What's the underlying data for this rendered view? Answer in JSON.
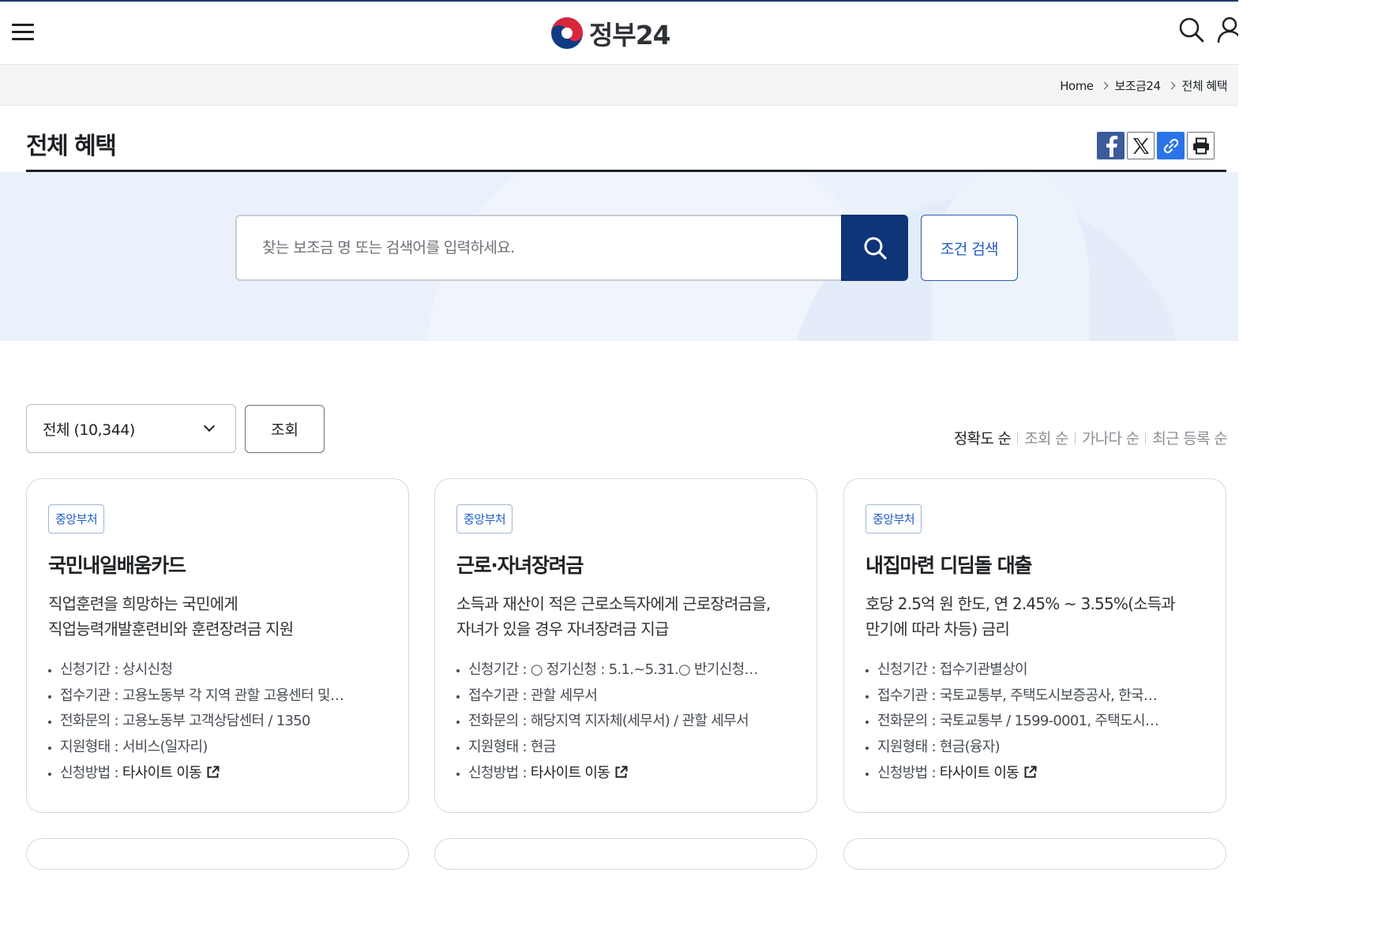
{
  "header": {
    "logo_text": "정부24"
  },
  "breadcrumb": [
    "Home",
    "보조금24",
    "전체 혜택"
  ],
  "page": {
    "title": "전체 혜택"
  },
  "search": {
    "placeholder": "찾는 보조금 명 또는 검색어를 입력하세요.",
    "condition_label": "조건 검색"
  },
  "filter": {
    "selected": "전체 (10,344)",
    "query_label": "조회"
  },
  "sort": [
    "정확도 순",
    "조회 순",
    "가나다 순",
    "최근 등록 순"
  ],
  "cards": [
    {
      "badge": "중앙부처",
      "title": "국민내일배움카드",
      "desc_line1": "직업훈련을 희망하는 국민에게",
      "desc_line2": "직업능력개발훈련비와 훈련장려금 지원",
      "info": [
        {
          "label": "신청기간 : ",
          "value": "상시신청"
        },
        {
          "label": "접수기관 : ",
          "value": "고용노동부 각 지역 관할 고용센터 및…"
        },
        {
          "label": "전화문의 : ",
          "value": "고용노동부 고객상담센터 / 1350"
        },
        {
          "label": "지원형태 : ",
          "value": "서비스(일자리)"
        },
        {
          "label": "신청방법 : ",
          "value": "타사이트 이동"
        }
      ]
    },
    {
      "badge": "중앙부처",
      "title": "근로·자녀장려금",
      "desc_line1": "소득과 재산이 적은 근로소득자에게 근로장려금을,",
      "desc_line2": "자녀가 있을 경우 자녀장려금 지급",
      "info": [
        {
          "label": "신청기간 : ",
          "value": "○ 정기신청 : 5.1.~5.31.○ 반기신청…"
        },
        {
          "label": "접수기관 : ",
          "value": "관할 세무서"
        },
        {
          "label": "전화문의 : ",
          "value": "해당지역 지자체(세무서) / 관할 세무서"
        },
        {
          "label": "지원형태 : ",
          "value": "현금"
        },
        {
          "label": "신청방법 : ",
          "value": "타사이트 이동"
        }
      ]
    },
    {
      "badge": "중앙부처",
      "title": "내집마련 디딤돌 대출",
      "desc_line1": "호당 2.5억 원 한도, 연 2.45% ~ 3.55%(소득과",
      "desc_line2": "만기에 따라 차등) 금리",
      "info": [
        {
          "label": "신청기간 : ",
          "value": "접수기관별상이"
        },
        {
          "label": "접수기관 : ",
          "value": "국토교통부, 주택도시보증공사, 한국…"
        },
        {
          "label": "전화문의 : ",
          "value": "국토교통부 / 1599-0001, 주택도시…"
        },
        {
          "label": "지원형태 : ",
          "value": "현금(융자)"
        },
        {
          "label": "신청방법 : ",
          "value": "타사이트 이동"
        }
      ]
    }
  ]
}
